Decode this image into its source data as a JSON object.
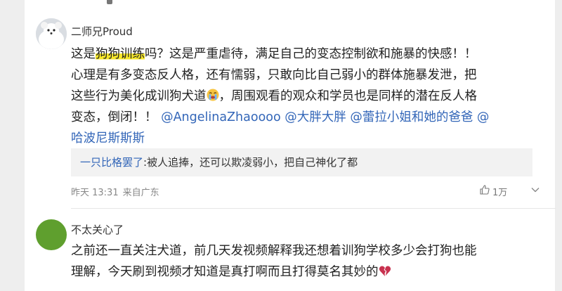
{
  "comment1": {
    "username": "二师兄Proud",
    "text_line1_pre": "这是",
    "text_line1_highlight": "狗狗训练",
    "text_line1_post": "吗？这是严重虐待，满足自己的变态控制欲和施暴的快感！！",
    "text_line2": "心理是有多变态反人格，还有懦弱，只敢向比自己弱小的群体施暴发泄，把",
    "text_line3_pre": "这些行为美化成训狗犬道",
    "text_line3_post": "，周围观看的观众和学员也是同样的潜在反人格",
    "text_line4_pre": "变态，倒闭！！",
    "mention1": "@AngelinaZhaoooo",
    "mention2": "@大胖大胖",
    "mention3": "@蕾拉小姐和她的爸爸",
    "mention4": "@",
    "mention4_line5": "哈波尼斯斯斯",
    "emoji_icon": "crying-face-icon",
    "quote": {
      "name": "一只比格罢了",
      "text": ":被人追捧，还可以欺凌弱小，把自己神化了都"
    },
    "time": "昨天 13:31",
    "location": "来自广东",
    "likes": "1万"
  },
  "comment2": {
    "username": "不太关心了",
    "text_line1": "之前还一直关注犬道，前几天发视频解释我还想着训狗学校多少会打狗也能",
    "text_line2": "理解，今天刷到视频才知道是真打啊而且打得莫名其妙的",
    "emoji_icon": "broken-heart-icon"
  },
  "colors": {
    "highlight": "#f7e82a",
    "mention": "#3366b8",
    "avatar2": "#5f9f2e"
  }
}
